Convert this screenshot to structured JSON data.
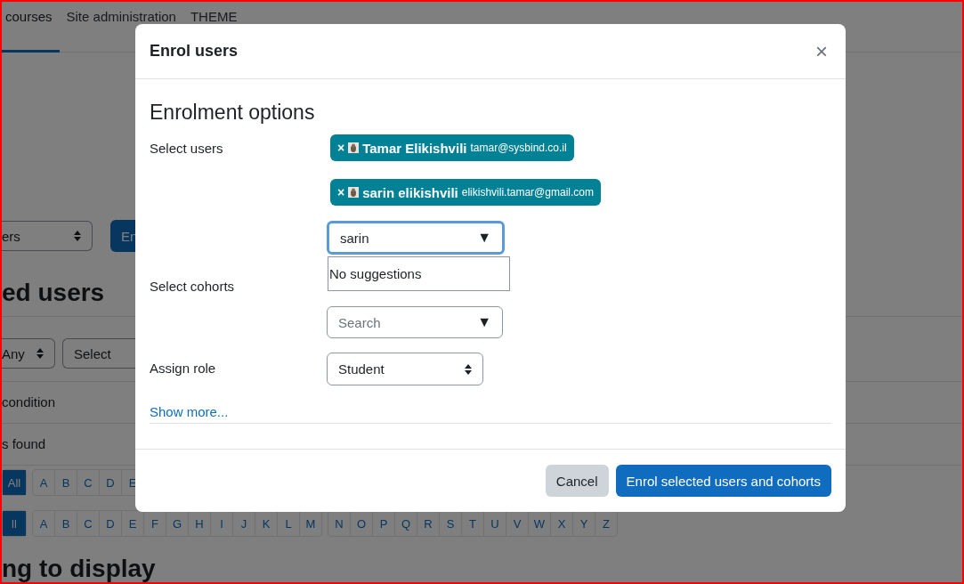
{
  "background": {
    "nav": [
      {
        "label": "courses",
        "selected": true
      },
      {
        "label": "Site administration",
        "selected": false
      },
      {
        "label": "THEME",
        "selected": false
      }
    ],
    "filter_select": "ers",
    "enrol_button": "En",
    "heading": "ed users",
    "match_select": "Any",
    "condition_select": "Select",
    "condition_text": "condition",
    "found_text": "s found",
    "first_name_bar": [
      [
        {
          "label": "All",
          "selected": true
        }
      ],
      [
        {
          "label": "A",
          "selected": false
        },
        {
          "label": "B",
          "selected": false
        },
        {
          "label": "C",
          "selected": false
        },
        {
          "label": "D",
          "selected": false
        },
        {
          "label": "E",
          "selected": false
        }
      ]
    ],
    "last_name_bar": [
      [
        {
          "label": "ll",
          "selected": true
        }
      ],
      [
        {
          "label": "A",
          "selected": false
        },
        {
          "label": "B",
          "selected": false
        },
        {
          "label": "C",
          "selected": false
        },
        {
          "label": "D",
          "selected": false
        },
        {
          "label": "E",
          "selected": false
        },
        {
          "label": "F",
          "selected": false
        },
        {
          "label": "G",
          "selected": false
        },
        {
          "label": "H",
          "selected": false
        },
        {
          "label": "I",
          "selected": false
        },
        {
          "label": "J",
          "selected": false
        },
        {
          "label": "K",
          "selected": false
        },
        {
          "label": "L",
          "selected": false
        },
        {
          "label": "M",
          "selected": false
        }
      ],
      [
        {
          "label": "N",
          "selected": false
        },
        {
          "label": "O",
          "selected": false
        },
        {
          "label": "P",
          "selected": false
        },
        {
          "label": "Q",
          "selected": false
        },
        {
          "label": "R",
          "selected": false
        },
        {
          "label": "S",
          "selected": false
        },
        {
          "label": "T",
          "selected": false
        },
        {
          "label": "U",
          "selected": false
        },
        {
          "label": "V",
          "selected": false
        },
        {
          "label": "W",
          "selected": false
        },
        {
          "label": "X",
          "selected": false
        },
        {
          "label": "Y",
          "selected": false
        },
        {
          "label": "Z",
          "selected": false
        }
      ]
    ],
    "empty_heading": "ng to display"
  },
  "dialog": {
    "title": "Enrol users",
    "close": "×",
    "section_title": "Enrolment options",
    "select_users": {
      "label": "Select users",
      "chips": [
        {
          "remove": "×",
          "name": "Tamar Elikishvili",
          "email": "tamar@sysbind.co.il"
        },
        {
          "remove": "×",
          "name": "sarin elikishvili",
          "email": "elikishvili.tamar@gmail.com"
        }
      ],
      "value": "sarin",
      "arrow": "▼",
      "suggestions": "No suggestions"
    },
    "select_cohorts": {
      "label": "Select cohorts",
      "placeholder": "Search",
      "arrow": "▼"
    },
    "assign_role": {
      "label": "Assign role",
      "value": "Student"
    },
    "show_more": "Show more...",
    "buttons": [
      {
        "label": "Cancel",
        "kind": "secondary"
      },
      {
        "label": "Enrol selected users and cohorts",
        "kind": "primary"
      }
    ]
  }
}
